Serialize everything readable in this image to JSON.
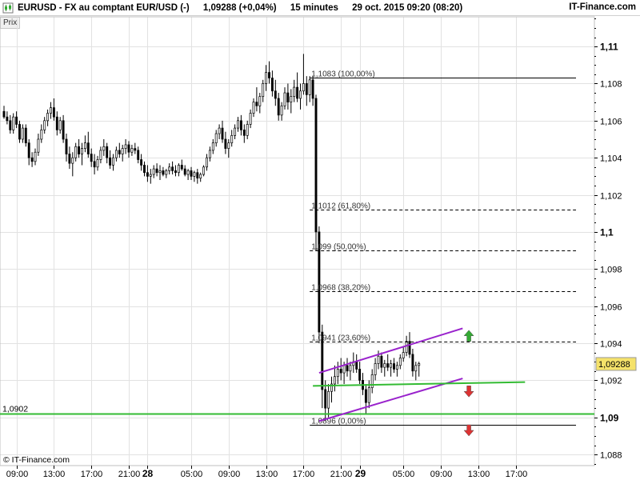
{
  "header": {
    "symbol": "EURUSD",
    "instrument": "FX au comptant EUR/USD (-)",
    "last": "1,09288 (+0,04%)",
    "interval": "15 minutes",
    "timestamp": "29 oct. 2015 09:20 (08:20)",
    "brand": "IT-Finance.com"
  },
  "panel_label": "Prix",
  "copyright": "© IT-Finance.com",
  "colors": {
    "candle": "#000000",
    "fib_line": "#000000",
    "support_line": "#33bb33",
    "channel_line": "#9922cc",
    "up_arrow": "#33aa33",
    "down_arrow": "#dd3333",
    "last_price_box": "#f5e26a"
  },
  "chart_data": {
    "type": "candlestick",
    "y_axis": {
      "range": [
        1.0874,
        1.1116
      ],
      "tick_values": [
        1.088,
        1.09,
        1.092,
        1.094,
        1.096,
        1.098,
        1.1,
        1.102,
        1.104,
        1.106,
        1.108,
        1.11
      ],
      "tick_labels": [
        "1,088",
        "1,09",
        "1,092",
        "1,094",
        "1,096",
        "1,098",
        "1,1",
        "1,102",
        "1,104",
        "1,106",
        "1,108",
        "1,11"
      ],
      "major_labels": [
        "1,09",
        "1,1",
        "1,11"
      ]
    },
    "x_axis": {
      "index_range": [
        0,
        155
      ],
      "ticks": [
        {
          "i": 4,
          "label": "09:00"
        },
        {
          "i": 16,
          "label": "13:00"
        },
        {
          "i": 28,
          "label": "17:00"
        },
        {
          "i": 40,
          "label": "21:00"
        },
        {
          "i": 46,
          "label": "28",
          "bold": true
        },
        {
          "i": 60,
          "label": "05:00"
        },
        {
          "i": 72,
          "label": "09:00"
        },
        {
          "i": 84,
          "label": "13:00"
        },
        {
          "i": 96,
          "label": "17:00"
        },
        {
          "i": 108,
          "label": "21:00"
        },
        {
          "i": 114,
          "label": "29",
          "bold": true
        },
        {
          "i": 128,
          "label": "05:00"
        },
        {
          "i": 140,
          "label": "09:00"
        },
        {
          "i": 152,
          "label": "13:00"
        },
        {
          "i": 164,
          "label": "17:00"
        }
      ]
    },
    "last_price": {
      "value": 1.09288,
      "label": "1,09288"
    },
    "support_line": {
      "value": 1.0902,
      "label": "1,0902"
    },
    "fibonacci": {
      "start_index": 98,
      "levels": [
        {
          "value": 1.1083,
          "label": "1,1083 (100,00%)",
          "style": "solid"
        },
        {
          "value": 1.1012,
          "label": "1,1012 (61,80%)",
          "style": "dashed"
        },
        {
          "value": 1.099,
          "label": "1,099 (50,00%)",
          "style": "dashed"
        },
        {
          "value": 1.0968,
          "label": "1,0968 (38,20%)",
          "style": "dashed"
        },
        {
          "value": 1.0941,
          "label": "1,0941 (23,60%)",
          "style": "dashed"
        },
        {
          "value": 1.0896,
          "label": "1,0896 (0,00%)",
          "style": "solid"
        }
      ]
    },
    "trend_lines": [
      {
        "name": "channel-upper",
        "from": [
          101,
          1.0924
        ],
        "to": [
          147,
          1.0948
        ],
        "color": "channel_line"
      },
      {
        "name": "channel-lower",
        "from": [
          101,
          1.0898
        ],
        "to": [
          147,
          1.0921
        ],
        "color": "channel_line"
      },
      {
        "name": "green-trend",
        "from": [
          99,
          1.0917
        ],
        "to": [
          167,
          1.0919
        ],
        "color": "support_line"
      }
    ],
    "signals": [
      {
        "type": "up",
        "index": 149,
        "value": 1.0944
      },
      {
        "type": "down",
        "index": 149,
        "value": 1.0914
      },
      {
        "type": "down",
        "index": 149,
        "value": 1.0893
      }
    ],
    "candles": [
      [
        1.1065,
        1.1068,
        1.1061,
        1.1062
      ],
      [
        1.1062,
        1.1065,
        1.1058,
        1.106
      ],
      [
        1.106,
        1.1063,
        1.1053,
        1.1055
      ],
      [
        1.1055,
        1.1064,
        1.1053,
        1.1062
      ],
      [
        1.1062,
        1.1065,
        1.1056,
        1.1058
      ],
      [
        1.1058,
        1.106,
        1.1048,
        1.105
      ],
      [
        1.105,
        1.1058,
        1.1048,
        1.1056
      ],
      [
        1.1056,
        1.1058,
        1.1046,
        1.1048
      ],
      [
        1.1048,
        1.105,
        1.1036,
        1.104
      ],
      [
        1.104,
        1.1043,
        1.1035,
        1.1038
      ],
      [
        1.1038,
        1.1045,
        1.1036,
        1.1043
      ],
      [
        1.1043,
        1.1053,
        1.1041,
        1.105
      ],
      [
        1.105,
        1.1058,
        1.1048,
        1.1055
      ],
      [
        1.1055,
        1.1062,
        1.1053,
        1.106
      ],
      [
        1.106,
        1.1066,
        1.1057,
        1.1064
      ],
      [
        1.1064,
        1.107,
        1.1061,
        1.1067
      ],
      [
        1.1067,
        1.1072,
        1.106,
        1.1062
      ],
      [
        1.1062,
        1.1065,
        1.1052,
        1.1055
      ],
      [
        1.1055,
        1.1062,
        1.1053,
        1.106
      ],
      [
        1.106,
        1.1063,
        1.1048,
        1.105
      ],
      [
        1.105,
        1.1053,
        1.1038,
        1.1042
      ],
      [
        1.1042,
        1.1046,
        1.1034,
        1.1037
      ],
      [
        1.1037,
        1.1043,
        1.103,
        1.104
      ],
      [
        1.104,
        1.1048,
        1.1038,
        1.1046
      ],
      [
        1.1046,
        1.105,
        1.104,
        1.1042
      ],
      [
        1.1042,
        1.1048,
        1.1036,
        1.1045
      ],
      [
        1.1045,
        1.1052,
        1.1043,
        1.1048
      ],
      [
        1.1048,
        1.1054,
        1.104,
        1.1042
      ],
      [
        1.1042,
        1.1045,
        1.1035,
        1.1038
      ],
      [
        1.1038,
        1.1042,
        1.1031,
        1.1035
      ],
      [
        1.1035,
        1.1041,
        1.1033,
        1.1039
      ],
      [
        1.1039,
        1.1046,
        1.1037,
        1.1044
      ],
      [
        1.1044,
        1.105,
        1.1041,
        1.1046
      ],
      [
        1.1046,
        1.1048,
        1.1037,
        1.104
      ],
      [
        1.104,
        1.1044,
        1.1034,
        1.1036
      ],
      [
        1.1036,
        1.1042,
        1.1033,
        1.104
      ],
      [
        1.104,
        1.1046,
        1.1038,
        1.1044
      ],
      [
        1.1044,
        1.1048,
        1.104,
        1.1042
      ],
      [
        1.1042,
        1.1047,
        1.1038,
        1.1045
      ],
      [
        1.1045,
        1.105,
        1.1042,
        1.1047
      ],
      [
        1.1047,
        1.1049,
        1.104,
        1.1043
      ],
      [
        1.1043,
        1.1047,
        1.1041,
        1.1045
      ],
      [
        1.1045,
        1.1048,
        1.1042,
        1.1044
      ],
      [
        1.1044,
        1.1046,
        1.1037,
        1.1039
      ],
      [
        1.1039,
        1.1042,
        1.1033,
        1.1036
      ],
      [
        1.1036,
        1.1038,
        1.103,
        1.1032
      ],
      [
        1.1032,
        1.1036,
        1.1027,
        1.103
      ],
      [
        1.103,
        1.1034,
        1.1026,
        1.1031
      ],
      [
        1.1031,
        1.1036,
        1.1029,
        1.1034
      ],
      [
        1.1034,
        1.1037,
        1.103,
        1.1032
      ],
      [
        1.1032,
        1.1036,
        1.1028,
        1.1033
      ],
      [
        1.1033,
        1.1035,
        1.103,
        1.1031
      ],
      [
        1.1031,
        1.1034,
        1.1029,
        1.1033
      ],
      [
        1.1033,
        1.1037,
        1.1031,
        1.1035
      ],
      [
        1.1035,
        1.1038,
        1.1031,
        1.1033
      ],
      [
        1.1033,
        1.1036,
        1.103,
        1.1032
      ],
      [
        1.1032,
        1.1037,
        1.103,
        1.1036
      ],
      [
        1.1036,
        1.1039,
        1.1033,
        1.1034
      ],
      [
        1.1034,
        1.1036,
        1.103,
        1.1031
      ],
      [
        1.1031,
        1.1034,
        1.1028,
        1.1033
      ],
      [
        1.1033,
        1.1035,
        1.1028,
        1.103
      ],
      [
        1.103,
        1.1033,
        1.1027,
        1.1032
      ],
      [
        1.1032,
        1.1034,
        1.1026,
        1.1029
      ],
      [
        1.1029,
        1.1032,
        1.1027,
        1.1031
      ],
      [
        1.1031,
        1.1036,
        1.103,
        1.1035
      ],
      [
        1.1035,
        1.1042,
        1.1033,
        1.104
      ],
      [
        1.104,
        1.1046,
        1.1038,
        1.1044
      ],
      [
        1.1044,
        1.105,
        1.1042,
        1.1048
      ],
      [
        1.1048,
        1.1055,
        1.1046,
        1.1053
      ],
      [
        1.1053,
        1.1058,
        1.105,
        1.1056
      ],
      [
        1.1056,
        1.106,
        1.1048,
        1.105
      ],
      [
        1.105,
        1.1054,
        1.1042,
        1.1045
      ],
      [
        1.1045,
        1.105,
        1.104,
        1.1048
      ],
      [
        1.1048,
        1.1055,
        1.1046,
        1.1052
      ],
      [
        1.1052,
        1.1058,
        1.105,
        1.1056
      ],
      [
        1.1056,
        1.1062,
        1.1054,
        1.106
      ],
      [
        1.106,
        1.1063,
        1.1052,
        1.1055
      ],
      [
        1.1055,
        1.1058,
        1.1048,
        1.1052
      ],
      [
        1.1052,
        1.106,
        1.105,
        1.1058
      ],
      [
        1.1058,
        1.1066,
        1.1056,
        1.1064
      ],
      [
        1.1064,
        1.1072,
        1.1062,
        1.107
      ],
      [
        1.107,
        1.1078,
        1.1065,
        1.1068
      ],
      [
        1.1068,
        1.1075,
        1.1064,
        1.1073
      ],
      [
        1.1073,
        1.1082,
        1.107,
        1.108
      ],
      [
        1.108,
        1.109,
        1.1076,
        1.1086
      ],
      [
        1.1086,
        1.1092,
        1.108,
        1.1083
      ],
      [
        1.1083,
        1.1087,
        1.1073,
        1.1076
      ],
      [
        1.1076,
        1.1082,
        1.1068,
        1.1072
      ],
      [
        1.1072,
        1.1075,
        1.106,
        1.1063
      ],
      [
        1.1063,
        1.107,
        1.106,
        1.1068
      ],
      [
        1.1068,
        1.1078,
        1.1066,
        1.1075
      ],
      [
        1.1075,
        1.108,
        1.1066,
        1.107
      ],
      [
        1.107,
        1.1077,
        1.1064,
        1.1073
      ],
      [
        1.1073,
        1.1082,
        1.107,
        1.1078
      ],
      [
        1.1078,
        1.1086,
        1.107,
        1.1072
      ],
      [
        1.1072,
        1.108,
        1.1066,
        1.1076
      ],
      [
        1.1076,
        1.1096,
        1.1074,
        1.108
      ],
      [
        1.108,
        1.1084,
        1.1068,
        1.1074
      ],
      [
        1.1074,
        1.1084,
        1.107,
        1.1082
      ],
      [
        1.1082,
        1.1084,
        1.1068,
        1.1072
      ],
      [
        1.1072,
        1.1074,
        1.099,
        1.1
      ],
      [
        1.1,
        1.1003,
        1.094,
        1.0946
      ],
      [
        1.0946,
        1.095,
        1.0905,
        1.0915
      ],
      [
        1.0915,
        1.092,
        1.0898,
        1.0905
      ],
      [
        1.0905,
        1.0918,
        1.09,
        1.0914
      ],
      [
        1.0914,
        1.0922,
        1.0908,
        1.0918
      ],
      [
        1.0918,
        1.0928,
        1.0914,
        1.0922
      ],
      [
        1.0922,
        1.093,
        1.0918,
        1.0926
      ],
      [
        1.0926,
        1.0932,
        1.092,
        1.0924
      ],
      [
        1.0924,
        1.093,
        1.0918,
        1.0928
      ],
      [
        1.0928,
        1.0932,
        1.0922,
        1.0925
      ],
      [
        1.0925,
        1.093,
        1.092,
        1.0928
      ],
      [
        1.0928,
        1.0935,
        1.0924,
        1.093
      ],
      [
        1.093,
        1.0934,
        1.0924,
        1.0926
      ],
      [
        1.0926,
        1.093,
        1.0918,
        1.092
      ],
      [
        1.092,
        1.0924,
        1.0912,
        1.0915
      ],
      [
        1.0915,
        1.0918,
        1.0902,
        1.0908
      ],
      [
        1.0908,
        1.092,
        1.0905,
        1.0916
      ],
      [
        1.0916,
        1.0926,
        1.0913,
        1.0923
      ],
      [
        1.0923,
        1.0932,
        1.092,
        1.0929
      ],
      [
        1.0929,
        1.0936,
        1.0926,
        1.0933
      ],
      [
        1.0933,
        1.0935,
        1.0924,
        1.0927
      ],
      [
        1.0927,
        1.0931,
        1.0922,
        1.0929
      ],
      [
        1.0929,
        1.0934,
        1.0925,
        1.0927
      ],
      [
        1.0927,
        1.0931,
        1.0922,
        1.0929
      ],
      [
        1.0929,
        1.0932,
        1.0924,
        1.0926
      ],
      [
        1.0926,
        1.093,
        1.0922,
        1.0928
      ],
      [
        1.0928,
        1.0934,
        1.0926,
        1.0932
      ],
      [
        1.0932,
        1.0938,
        1.093,
        1.0935
      ],
      [
        1.0935,
        1.0944,
        1.0933,
        1.0941
      ],
      [
        1.0941,
        1.0946,
        1.0932,
        1.0934
      ],
      [
        1.0934,
        1.0937,
        1.0922,
        1.0925
      ],
      [
        1.0925,
        1.093,
        1.092,
        1.0928
      ],
      [
        1.0928,
        1.093,
        1.0922,
        1.0929
      ]
    ]
  }
}
